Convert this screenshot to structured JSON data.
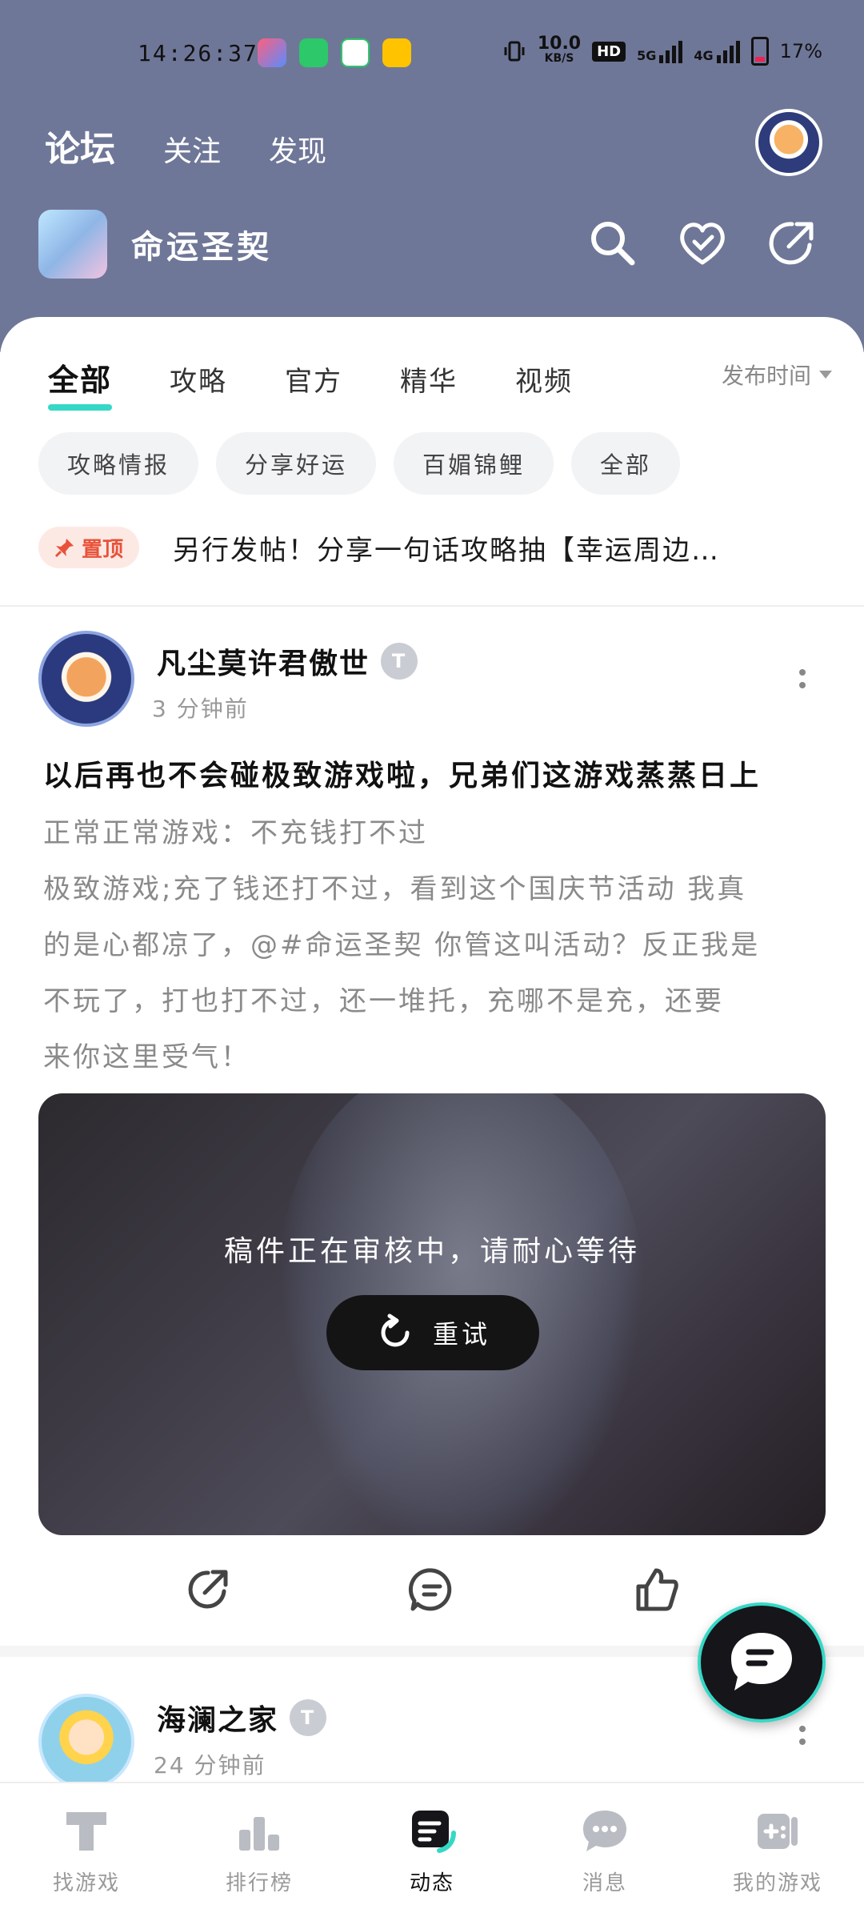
{
  "status_bar": {
    "time": "14:26:37",
    "net_speed": "10.0",
    "net_unit": "KB/S",
    "hd": "HD",
    "net1": "5G",
    "net2": "4G",
    "battery": "17%"
  },
  "top_tabs": [
    "论坛",
    "关注",
    "发现"
  ],
  "game": {
    "name": "命运圣契"
  },
  "sub_tabs": [
    "全部",
    "攻略",
    "官方",
    "精华",
    "视频"
  ],
  "sort": {
    "label": "发布时间"
  },
  "chips": [
    "攻略情报",
    "分享好运",
    "百媚锦鲤",
    "全部"
  ],
  "pinned": {
    "badge": "置顶",
    "text": "另行发帖！分享一句话攻略抽【幸运周边…"
  },
  "posts": [
    {
      "author": "凡尘莫许君傲世",
      "level": "T",
      "time": "3 分钟前",
      "title": "以后再也不会碰极致游戏啦，兄弟们这游戏蒸蒸日上",
      "body": [
        "正常正常游戏：不充钱打不过",
        "极致游戏;充了钱还打不过，看到这个国庆节活动 我真",
        "的是心都凉了，@#命运圣契 你管这叫活动？反正我是",
        "不玩了，打也打不过，还一堆托，充哪不是充，还要",
        "来你这里受气！"
      ],
      "media_status": "稿件正在审核中，请耐心等待",
      "retry_label": "重试"
    },
    {
      "author": "海澜之家",
      "level": "T",
      "time": "24 分钟前"
    }
  ],
  "bottom_nav": [
    "找游戏",
    "排行榜",
    "动态",
    "消息",
    "我的游戏"
  ],
  "colors": {
    "header": "#6f7798",
    "accent": "#35d8c6",
    "pin": "#e8523a"
  }
}
